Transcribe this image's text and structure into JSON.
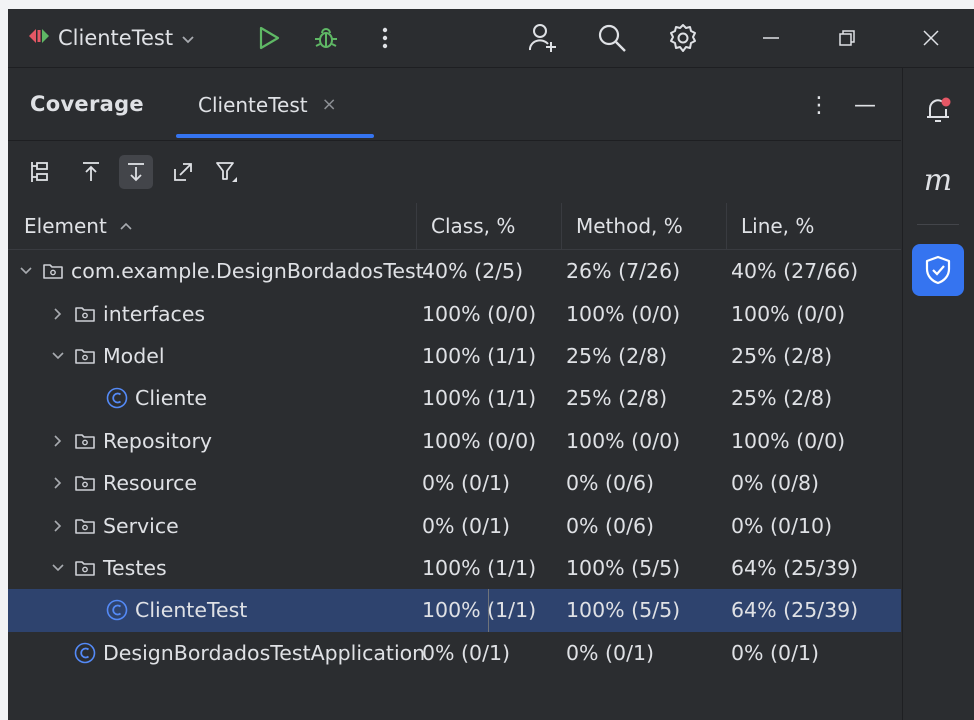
{
  "titlebar": {
    "run_config_label": "ClienteTest",
    "icons": [
      "run-config-icon",
      "chevron-down-icon",
      "run-icon",
      "debug-icon",
      "more-vertical-icon",
      "add-user-icon",
      "search-icon",
      "settings-icon",
      "minimize-icon",
      "restore-icon",
      "close-icon"
    ]
  },
  "panel": {
    "title": "Coverage",
    "tab_label": "ClienteTest",
    "tab_close": "×",
    "more_glyph": "⋮",
    "hide_glyph": "—"
  },
  "table": {
    "headers": {
      "element": "Element",
      "sort_glyph": "^",
      "class": "Class, %",
      "method": "Method, %",
      "line": "Line, %"
    },
    "rows": [
      {
        "name": "com.example.DesignBordadosTest",
        "kind": "package",
        "expand": "open",
        "level": 0,
        "class": "40% (2/5)",
        "method": "26% (7/26)",
        "line": "40% (27/66)"
      },
      {
        "name": "interfaces",
        "kind": "package",
        "expand": "closed",
        "level": 1,
        "class": "100% (0/0)",
        "method": "100% (0/0)",
        "line": "100% (0/0)"
      },
      {
        "name": "Model",
        "kind": "package",
        "expand": "open",
        "level": 1,
        "class": "100% (1/1)",
        "method": "25% (2/8)",
        "line": "25% (2/8)"
      },
      {
        "name": "Cliente",
        "kind": "class",
        "expand": "none",
        "level": 2,
        "class": "100% (1/1)",
        "method": "25% (2/8)",
        "line": "25% (2/8)"
      },
      {
        "name": "Repository",
        "kind": "package",
        "expand": "closed",
        "level": 1,
        "class": "100% (0/0)",
        "method": "100% (0/0)",
        "line": "100% (0/0)"
      },
      {
        "name": "Resource",
        "kind": "package",
        "expand": "closed",
        "level": 1,
        "class": "0% (0/1)",
        "method": "0% (0/6)",
        "line": "0% (0/8)"
      },
      {
        "name": "Service",
        "kind": "package",
        "expand": "closed",
        "level": 1,
        "class": "0% (0/1)",
        "method": "0% (0/6)",
        "line": "0% (0/10)"
      },
      {
        "name": "Testes",
        "kind": "package",
        "expand": "open",
        "level": 1,
        "class": "100% (1/1)",
        "method": "100% (5/5)",
        "line": "64% (25/39)"
      },
      {
        "name": "ClienteTest",
        "kind": "class",
        "expand": "none",
        "level": 2,
        "class": "100% (1/1)",
        "method": "100% (5/5)",
        "line": "64% (25/39)",
        "selected": true
      },
      {
        "name": "DesignBordadosTestApplication",
        "kind": "class",
        "expand": "none",
        "level": 1,
        "class": "0% (0/1)",
        "method": "0% (0/1)",
        "line": "0% (0/1)"
      }
    ]
  },
  "stripe": {
    "icons": [
      "notifications-icon",
      "m-icon",
      "coverage-shield-icon"
    ],
    "m_label": "m"
  },
  "colors": {
    "background": "#2b2d30",
    "selection": "#2e436e",
    "accent": "#3574f0",
    "run_green": "#5fb865",
    "class_icon_blue": "#548af7",
    "notification_dot": "#e55765"
  }
}
